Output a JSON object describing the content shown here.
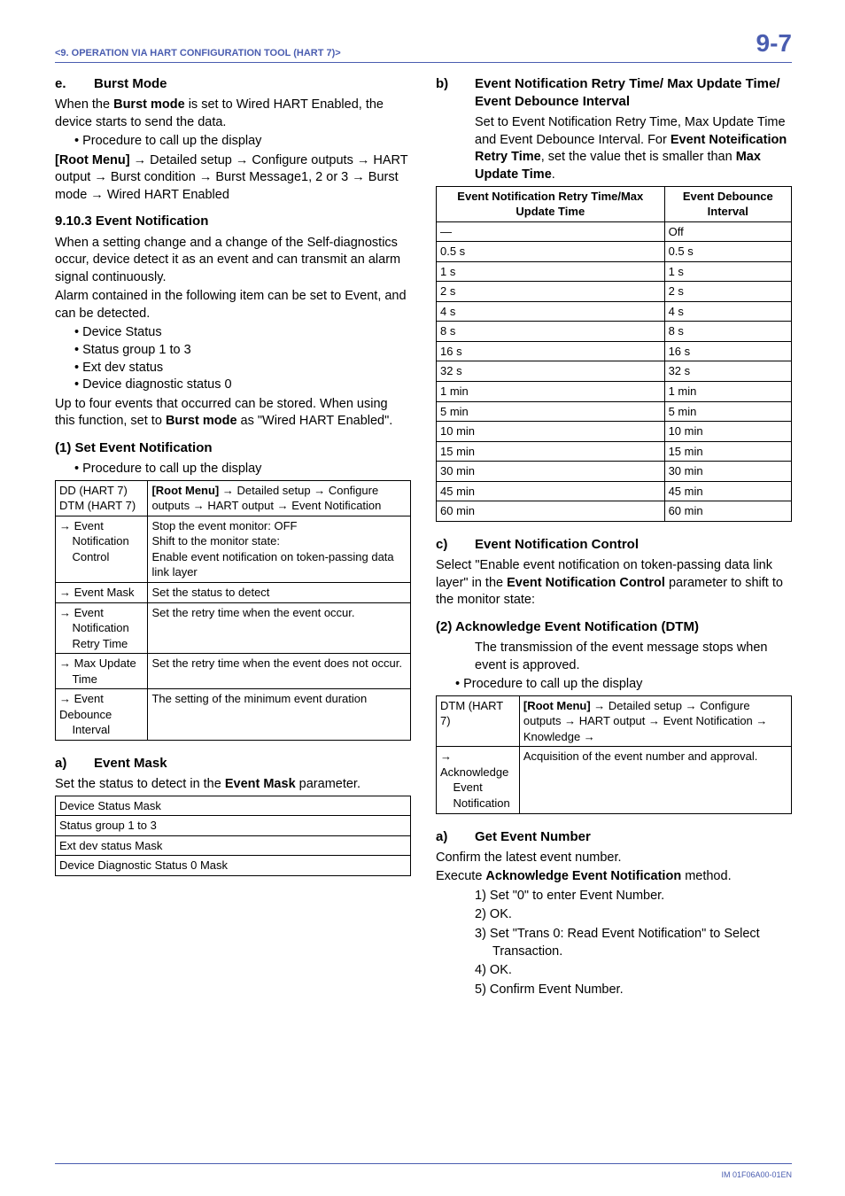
{
  "header": {
    "chapter": "<9.  OPERATION VIA HART CONFIGURATION TOOL (HART 7)>",
    "page": "9-7"
  },
  "left": {
    "e_title": "Burst Mode",
    "e_p1a": "When the ",
    "e_p1b": "Burst mode",
    "e_p1c": " is set to Wired HART Enabled, the device starts to send the data.",
    "e_bul1": "Procedure to call up the display",
    "e_nav1": "[Root Menu]",
    "e_nav2": " → Detailed setup → Configure outputs → HART output → Burst condition → Burst Message1, 2 or 3 → Burst mode → Wired HART Enabled",
    "s9103_title": "9.10.3 Event Notification",
    "s9103_p1": "When a setting change and a change of the Self-diagnostics occur, device detect it as an event and can transmit an alarm signal continuously.",
    "s9103_p2": "Alarm contained in the following item can be set to Event, and can be detected.",
    "s9103_items": [
      "Device Status",
      "Status group 1 to 3",
      "Ext dev status",
      "Device diagnostic status 0"
    ],
    "s9103_p3a": "Up to four events that occurred can be stored. When using this function, set to ",
    "s9103_p3b": "Burst mode",
    "s9103_p3c": " as \"Wired HART Enabled\".",
    "set_evt_title": "(1) Set Event Notification",
    "set_evt_bul": "Procedure to call up the display",
    "t1": {
      "rows": [
        [
          "DD (HART 7)\nDTM (HART 7)",
          "<b>[Root Menu]</b> → Detailed setup → Configure outputs → HART output → Event Notification"
        ],
        [
          "→ Event\n    Notification\n    Control",
          "Stop the event monitor: OFF\nShift to the monitor state:\nEnable event notification on token-passing data\nlink layer"
        ],
        [
          "→ Event Mask",
          "Set the status to detect"
        ],
        [
          "→ Event\n    Notification\n    Retry Time",
          "Set the retry time when the event occur."
        ],
        [
          "→ Max Update\n    Time",
          "Set the retry time when the event does not occur."
        ],
        [
          "→ Event Debounce\n    Interval",
          "The setting of the minimum event duration"
        ]
      ]
    },
    "a_title": "Event Mask",
    "a_p1a": "Set the status to detect in the ",
    "a_p1b": "Event Mask",
    "a_p1c": " parameter.",
    "t2_rows": [
      "Device Status Mask",
      "Status group 1 to 3",
      "Ext dev status Mask",
      "Device Diagnostic Status 0 Mask"
    ]
  },
  "right": {
    "b_title": "Event Notification Retry Time/ Max Update Time/ Event Debounce Interval",
    "b_p1a": "Set to Event Notification Retry Time, Max Update Time and Event Debounce Interval. For ",
    "b_p1b": "Event Noteification Retry Time",
    "b_p1c": ", set the value thet is smaller than ",
    "b_p1d": "Max Update Time",
    "b_p1e": ".",
    "t3_head": [
      "Event Notification Retry Time/Max Update Time",
      "Event Debounce Interval"
    ],
    "t3_rows": [
      [
        "—",
        "Off"
      ],
      [
        "0.5 s",
        "0.5 s"
      ],
      [
        "1 s",
        "1 s"
      ],
      [
        "2 s",
        "2 s"
      ],
      [
        "4 s",
        "4 s"
      ],
      [
        "8 s",
        "8 s"
      ],
      [
        "16 s",
        "16 s"
      ],
      [
        "32 s",
        "32 s"
      ],
      [
        "1 min",
        "1 min"
      ],
      [
        "5 min",
        "5 min"
      ],
      [
        "10 min",
        "10 min"
      ],
      [
        "15 min",
        "15 min"
      ],
      [
        "30 min",
        "30 min"
      ],
      [
        "45 min",
        "45 min"
      ],
      [
        "60 min",
        "60 min"
      ]
    ],
    "c_title": "Event Notification Control",
    "c_p1a": "Select \"Enable event notification on token-passing data link layer\" in the ",
    "c_p1b": "Event Notification Control",
    "c_p1c": " parameter to shift to the monitor state:",
    "ack_title": "(2) Acknowledge Event Notification (DTM)",
    "ack_p1": "The transmission of the event message stops when event is approved.",
    "ack_bul": "Procedure to call up the display",
    "t4": {
      "rows": [
        [
          "DTM (HART 7)",
          "<b>[Root Menu]</b> → Detailed setup → Configure outputs → HART output → Event Notification → Knowledge →"
        ],
        [
          "→ Acknowledge\n    Event\n    Notification",
          "Acquisition of the event number and approval."
        ]
      ]
    },
    "a2_title": "Get Event Number",
    "a2_p1": "Confirm the latest event number.",
    "a2_p2a": "Execute ",
    "a2_p2b": "Acknowledge Event Notification",
    "a2_p2c": " method.",
    "steps": [
      "1) Set \"0\" to enter Event Number.",
      "2) OK.",
      "3) Set \"Trans 0: Read Event Notification\" to Select Transaction.",
      "4) OK.",
      "5) Confirm Event Number."
    ]
  },
  "footer": "IM 01F06A00-01EN"
}
